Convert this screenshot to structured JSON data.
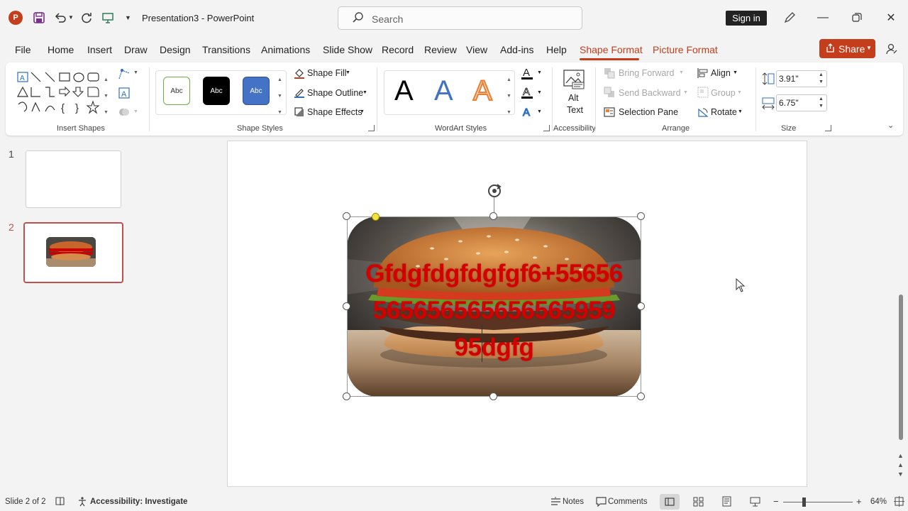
{
  "titlebar": {
    "app_letter": "P",
    "doc_title": "Presentation3  -  PowerPoint",
    "search_placeholder": "Search",
    "signin_label": "Sign in"
  },
  "tabs": [
    "File",
    "Home",
    "Insert",
    "Draw",
    "Design",
    "Transitions",
    "Animations",
    "Slide Show",
    "Record",
    "Review",
    "View",
    "Add-ins",
    "Help",
    "Shape Format",
    "Picture Format"
  ],
  "active_tabs": [
    "Shape Format",
    "Picture Format"
  ],
  "share_label": "Share",
  "ribbon": {
    "insert_shapes_label": "Insert Shapes",
    "shape_styles_label": "Shape Styles",
    "swatch_text": "Abc",
    "shape_fill": "Shape Fill",
    "shape_outline": "Shape Outline",
    "shape_effects": "Shape Effects",
    "wordart_label": "WordArt Styles",
    "wordart_letter": "A",
    "alt_text_line1": "Alt",
    "alt_text_line2": "Text",
    "accessibility_label": "Accessibility",
    "bring_forward": "Bring Forward",
    "send_backward": "Send Backward",
    "selection_pane": "Selection Pane",
    "align": "Align",
    "group": "Group",
    "rotate": "Rotate",
    "arrange_label": "Arrange",
    "height_value": "3.91\"",
    "width_value": "6.75\"",
    "size_label": "Size"
  },
  "slides_pane": {
    "numbers": [
      "1",
      "2"
    ]
  },
  "slide": {
    "text_lines": [
      "Gfdgfdgfdgfgf6+55656",
      "565656565656565959",
      "95dgfg"
    ]
  },
  "statusbar": {
    "slide_count": "Slide 2 of 2",
    "accessibility": "Accessibility: Investigate",
    "notes": "Notes",
    "comments": "Comments",
    "zoom": "64%"
  },
  "colors": {
    "accent": "#c43e1c",
    "slide_text": "#d40000"
  }
}
